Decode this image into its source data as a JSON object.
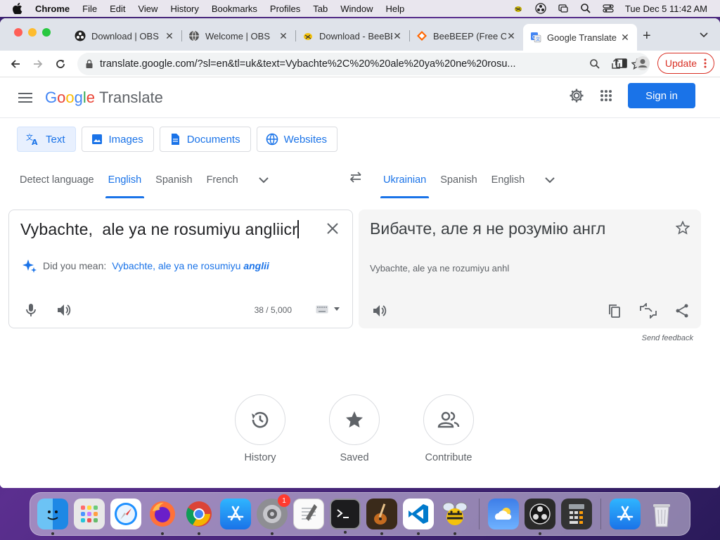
{
  "menubar": {
    "app": "Chrome",
    "items": [
      "File",
      "Edit",
      "View",
      "History",
      "Bookmarks",
      "Profiles",
      "Tab",
      "Window",
      "Help"
    ],
    "clock": "Tue Dec 5  11:42 AM"
  },
  "browser": {
    "tabs": [
      {
        "title": "Download | OBS",
        "icon": "obs-icon"
      },
      {
        "title": "Welcome | OBS",
        "icon": "globe-icon"
      },
      {
        "title": "Download - BeeBEEP",
        "icon": "beebeep-icon"
      },
      {
        "title": "BeeBEEP (Free Office Messenger)",
        "icon": "sourceforge-icon"
      },
      {
        "title": "Google Translate",
        "icon": "google-translate-icon"
      }
    ],
    "url": "translate.google.com/?sl=en&tl=uk&text=Vybachte%2C%20%20ale%20ya%20ne%20rosu...",
    "update_label": "Update"
  },
  "translate": {
    "logo_google": [
      "G",
      "o",
      "o",
      "g",
      "l",
      "e"
    ],
    "logo_product": "Translate",
    "sign_in": "Sign in",
    "modes": [
      {
        "label": "Text",
        "icon": "translate-icon"
      },
      {
        "label": "Images",
        "icon": "image-icon"
      },
      {
        "label": "Documents",
        "icon": "document-icon"
      },
      {
        "label": "Websites",
        "icon": "globe-icon"
      }
    ],
    "source_langs": [
      "Detect language",
      "English",
      "Spanish",
      "French"
    ],
    "target_langs": [
      "Ukrainian",
      "Spanish",
      "English"
    ],
    "source_text": "Vybachte,  ale ya ne rosumiyu angliicr",
    "did_you_mean_label": "Did you mean:",
    "suggestion_plain": "Vybachte, ale ya ne rosumiyu ",
    "suggestion_emph": "anglii",
    "char_count": "38 / 5,000",
    "target_text": "Вибачте, але я не розумію англ",
    "transliteration": "Vybachte, ale ya ne rozumiyu anhl",
    "send_feedback": "Send feedback",
    "bottom_actions": [
      {
        "label": "History",
        "icon": "history-icon"
      },
      {
        "label": "Saved",
        "icon": "star-icon"
      },
      {
        "label": "Contribute",
        "icon": "people-icon"
      }
    ]
  },
  "dock": {
    "settings_badge": "1"
  },
  "colors": {
    "accent": "#1a73e8",
    "update": "#d93025"
  }
}
